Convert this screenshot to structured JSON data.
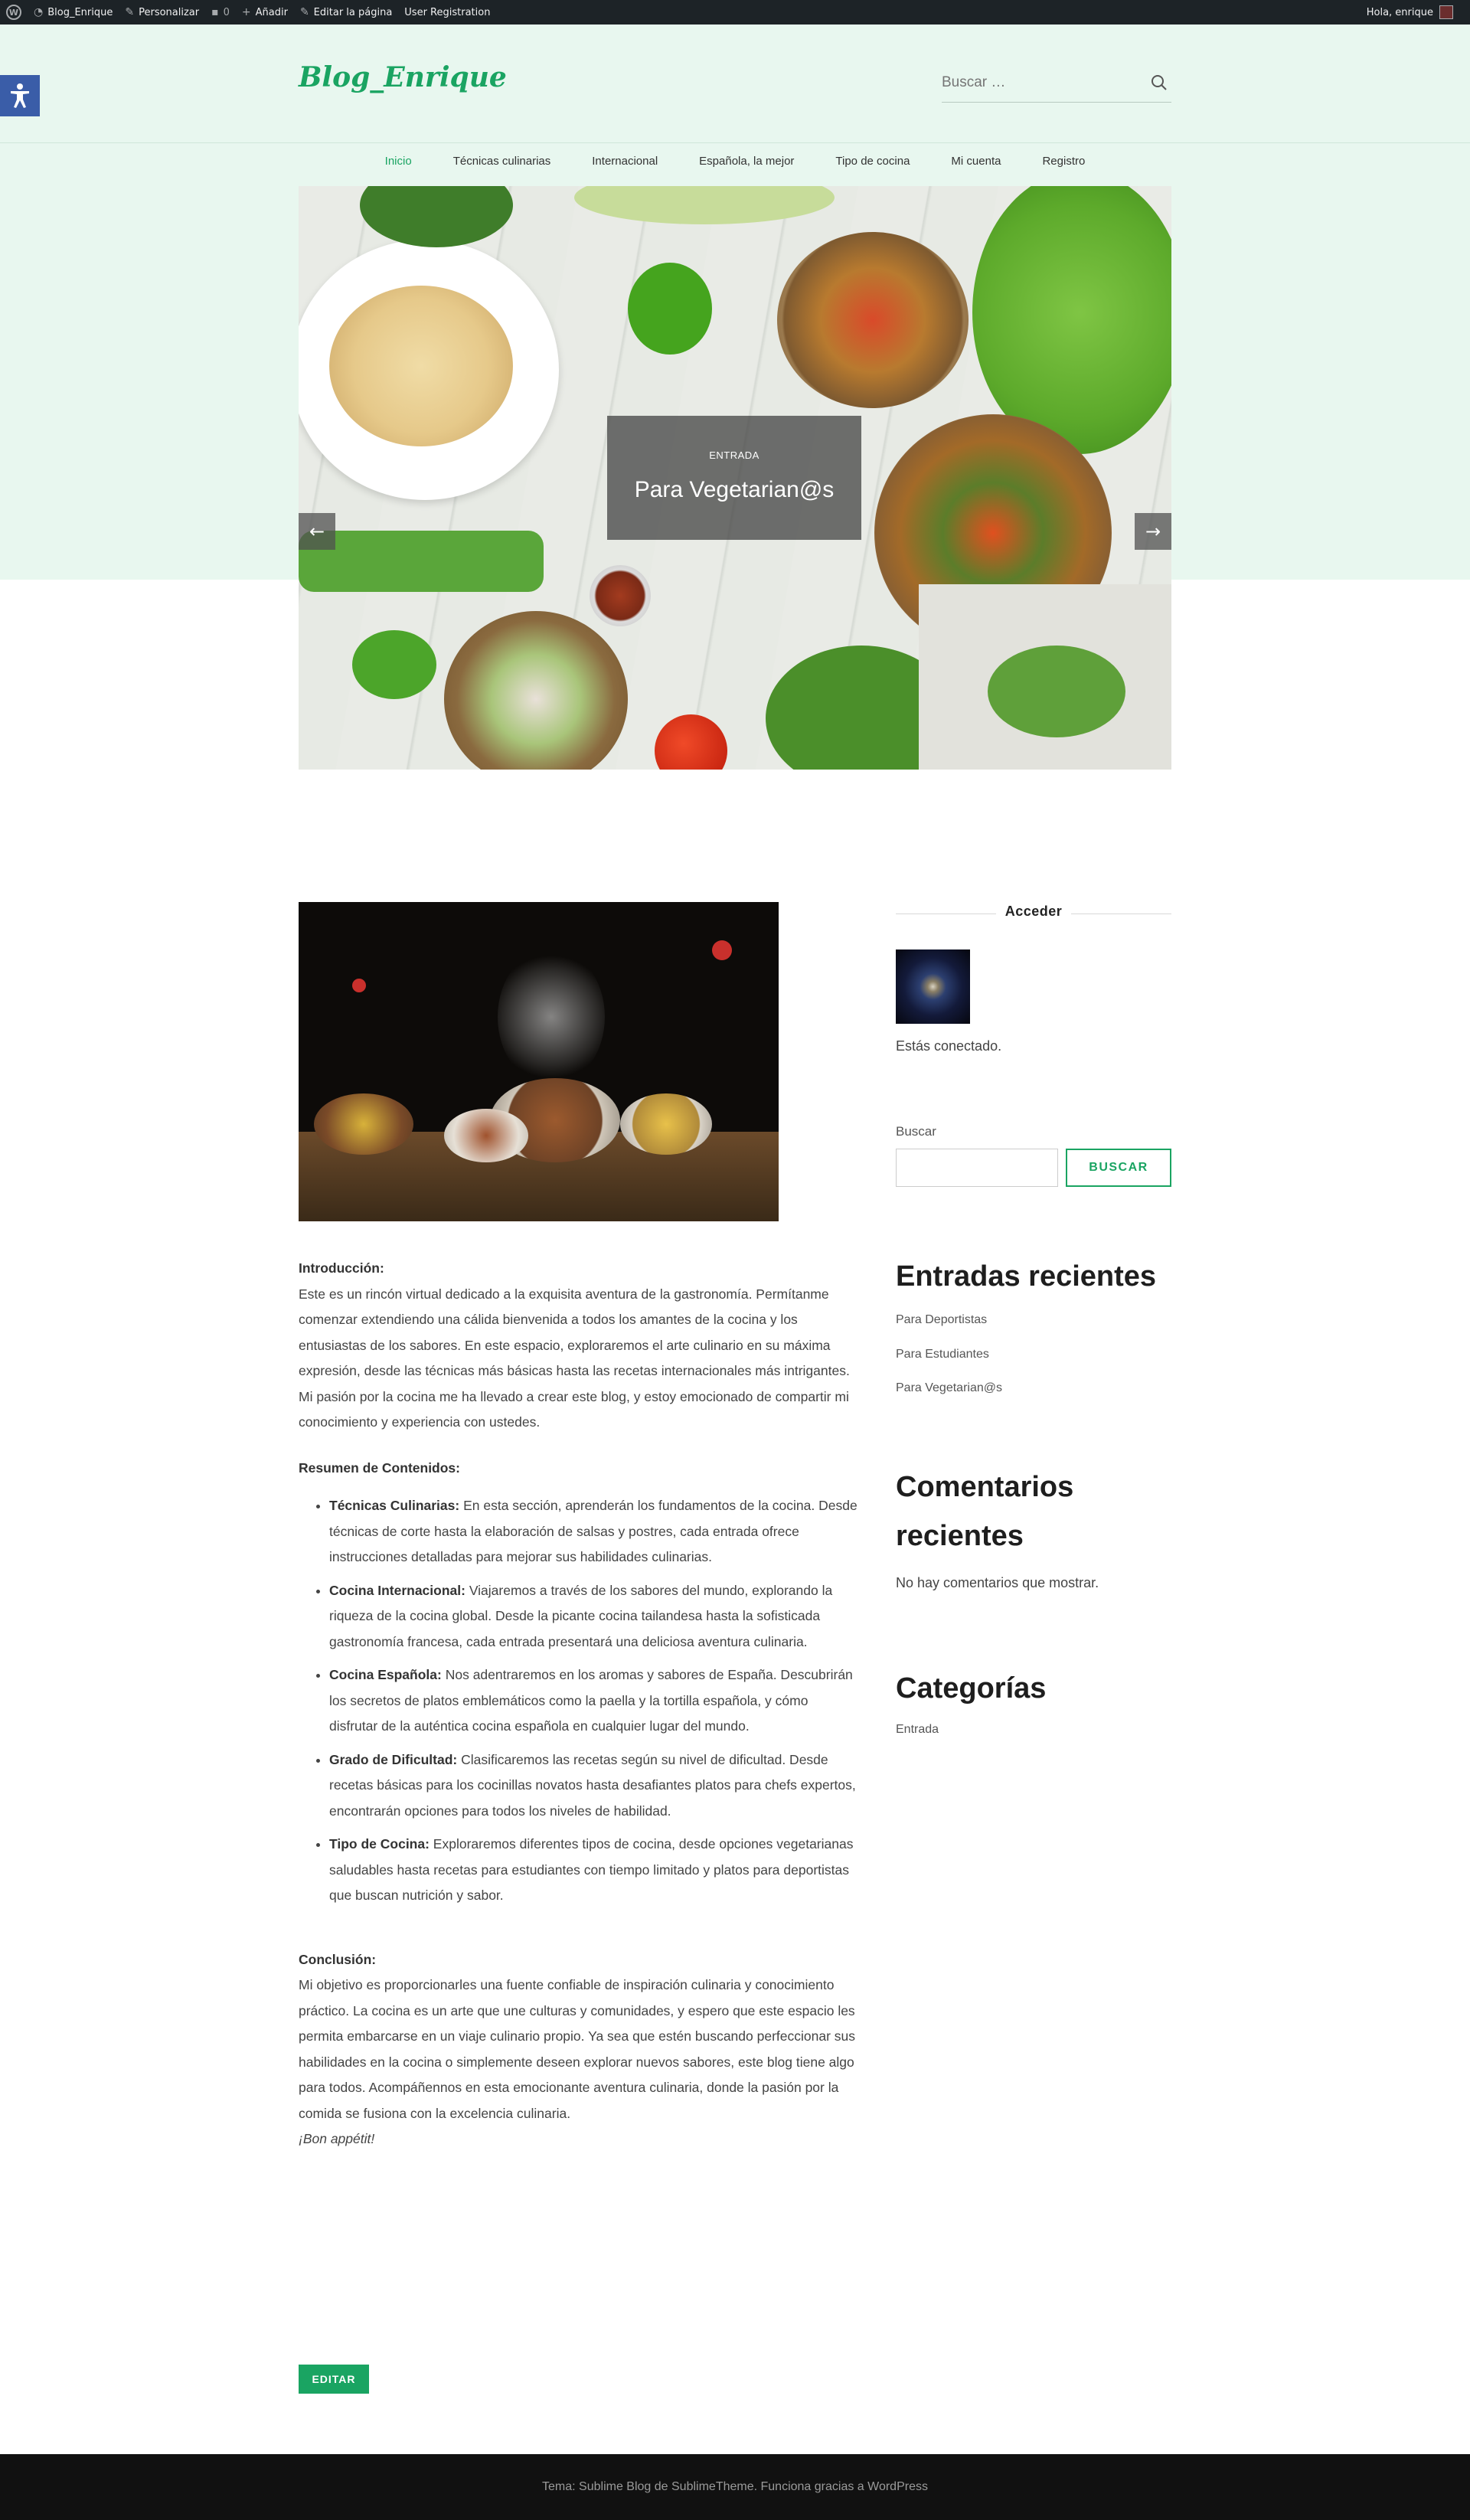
{
  "adminbar": {
    "site_name": "Blog_Enrique",
    "customize": "Personalizar",
    "comments_count": "0",
    "add_new": "Añadir",
    "edit_page": "Editar la página",
    "user_registration": "User Registration",
    "greeting": "Hola, enrique"
  },
  "header": {
    "site_title": "Blog_Enrique",
    "search_placeholder": "Buscar …"
  },
  "nav": {
    "items": [
      "Inicio",
      "Técnicas culinarias",
      "Internacional",
      "Española, la mejor",
      "Tipo de cocina",
      "Mi cuenta",
      "Registro"
    ],
    "active_index": 0
  },
  "hero": {
    "category": "ENTRADA",
    "title": "Para Vegetarian@s"
  },
  "article": {
    "intro_heading": "Introducción:",
    "intro_text": "Este es un rincón virtual dedicado a la exquisita aventura de la gastronomía. Permítanme comenzar extendiendo una cálida bienvenida a todos los amantes de la cocina y los entusiastas de los sabores. En este espacio, exploraremos el arte culinario en su máxima expresión, desde las técnicas más básicas hasta las recetas internacionales más intrigantes. Mi pasión por la cocina me ha llevado a crear este blog, y estoy emocionado de compartir mi conocimiento y experiencia con ustedes.",
    "summary_heading": "Resumen de Contenidos:",
    "items": [
      {
        "label": "Técnicas Culinarias:",
        "text": " En esta sección, aprenderán los fundamentos de la cocina. Desde técnicas de corte hasta la elaboración de salsas y postres, cada entrada ofrece instrucciones detalladas para mejorar sus habilidades culinarias."
      },
      {
        "label": "Cocina Internacional:",
        "text": " Viajaremos a través de los sabores del mundo, explorando la riqueza de la cocina global. Desde la picante cocina tailandesa hasta la sofisticada gastronomía francesa, cada entrada presentará una deliciosa aventura culinaria."
      },
      {
        "label": "Cocina Española:",
        "text": " Nos adentraremos en los aromas y sabores de España. Descubrirán los secretos de platos emblemáticos como la paella y la tortilla española, y cómo disfrutar de la auténtica cocina española en cualquier lugar del mundo."
      },
      {
        "label": "Grado de Dificultad:",
        "text": " Clasificaremos las recetas según su nivel de dificultad. Desde recetas básicas para los cocinillas novatos hasta desafiantes platos para chefs expertos, encontrarán opciones para todos los niveles de habilidad."
      },
      {
        "label": "Tipo de Cocina:",
        "text": " Exploraremos diferentes tipos de cocina, desde opciones vegetarianas saludables hasta recetas para estudiantes con tiempo limitado y platos para deportistas que buscan nutrición y sabor."
      }
    ],
    "conclusion_heading": "Conclusión:",
    "conclusion_text": "Mi objetivo es proporcionarles una fuente confiable de inspiración culinaria y conocimiento práctico. La cocina es un arte que une culturas y comunidades, y espero que este espacio les permita embarcarse en un viaje culinario propio. Ya sea que estén buscando perfeccionar sus habilidades en la cocina o simplemente deseen explorar nuevos sabores, este blog tiene algo para todos. Acompáñennos en esta emocionante aventura culinaria, donde la pasión por la comida se fusiona con la excelencia culinaria.",
    "signoff": "¡Bon appétit!",
    "edit_label": "EDITAR"
  },
  "sidebar": {
    "login_heading": "Acceder",
    "connected_text": "Estás conectado.",
    "search_label": "Buscar",
    "search_button": "BUSCAR",
    "recent_posts_title": "Entradas recientes",
    "recent_posts": [
      "Para Deportistas",
      "Para Estudiantes",
      "Para Vegetarian@s"
    ],
    "recent_comments_title": "Comentarios recientes",
    "no_comments": "No hay comentarios que mostrar.",
    "categories_title": "Categorías",
    "categories": [
      "Entrada"
    ]
  },
  "footer": {
    "text": "Tema: Sublime Blog de SublimeTheme. Funciona gracias a WordPress"
  },
  "colors": {
    "accent": "#1aa462",
    "header_bg": "#e8f7ef",
    "adminbar_bg": "#1d2327",
    "footer_bg": "#111111",
    "accessibility_bg": "#3a5da8"
  }
}
